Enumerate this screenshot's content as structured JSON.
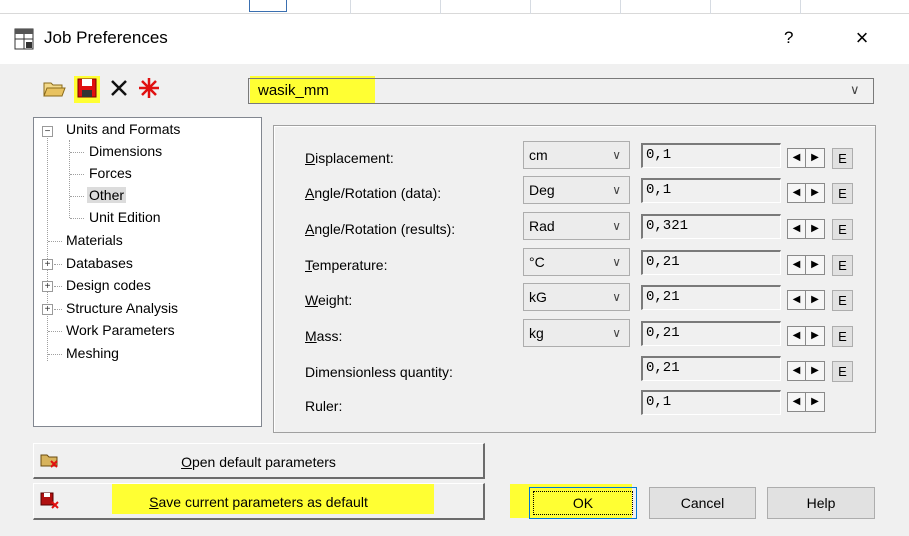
{
  "window": {
    "title": "Job Preferences",
    "help_label": "?",
    "close_label": "×"
  },
  "toolbar": {
    "icons": [
      "open-folder-icon",
      "save-icon",
      "delete-icon",
      "reset-icon"
    ],
    "preset_value": "wasik_mm",
    "highlight_color": "#ffff33"
  },
  "tree": {
    "items": [
      {
        "label": "Units and Formats",
        "expanded": true
      },
      {
        "label": "Dimensions"
      },
      {
        "label": "Forces"
      },
      {
        "label": "Other",
        "selected": true
      },
      {
        "label": "Unit Edition"
      },
      {
        "label": "Materials"
      },
      {
        "label": "Databases",
        "expandable": true
      },
      {
        "label": "Design codes",
        "expandable": true
      },
      {
        "label": "Structure Analysis",
        "expandable": true
      },
      {
        "label": "Work Parameters"
      },
      {
        "label": "Meshing"
      }
    ],
    "expander_minus": "−",
    "expander_plus": "+"
  },
  "rows": [
    {
      "u": "D",
      "rest": "isplacement:",
      "unit": "cm",
      "value": "0,1"
    },
    {
      "u": "A",
      "rest": "ngle/Rotation (data):",
      "unit": "Deg",
      "value": "0,1"
    },
    {
      "u": "A",
      "rest": "ngle/Rotation (results):",
      "unit": "Rad",
      "value": "0,321"
    },
    {
      "u": "T",
      "rest": "emperature:",
      "unit": "°C",
      "value": "0,21"
    },
    {
      "u": "W",
      "rest": "eight:",
      "unit": "kG",
      "value": "0,21"
    },
    {
      "u": "M",
      "rest": "ass:",
      "unit": "kg",
      "value": "0,21"
    },
    {
      "u": "",
      "rest": "Dimensionless quantity:",
      "unit": "",
      "value": "0,21"
    },
    {
      "u": "",
      "rest": "Ruler:",
      "unit": "",
      "value": "0,1"
    }
  ],
  "spin": {
    "left": "◀",
    "right": "▶"
  },
  "e_label": "E",
  "combo_arrow": "∨",
  "buttons": {
    "open_default_u": "O",
    "open_default_rest": "pen default parameters",
    "save_default_u": "S",
    "save_default_rest": "ave current parameters as default",
    "ok": "OK",
    "cancel": "Cancel",
    "help": "Help"
  }
}
